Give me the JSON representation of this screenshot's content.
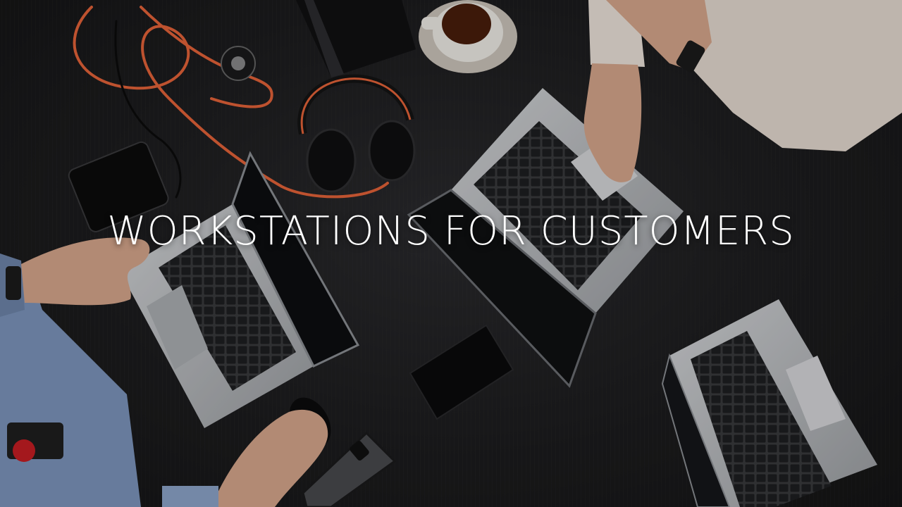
{
  "hero": {
    "headline": "WORKSTATIONS FOR CUSTOMERS"
  },
  "colors": {
    "table": "#1f1f21",
    "laptop_silver": "#bfc2c6",
    "keyboard": "#2a2b2e",
    "cable_orange": "#e8643a",
    "sleeve_beige": "#e8ddd3",
    "shirt_blue": "#7e97bf",
    "skin": "#d9a98e",
    "text": "#ffffff"
  },
  "icons": [
    "laptop-icon",
    "headphones-icon",
    "phone-icon",
    "coffee-cup-icon",
    "mouse-icon",
    "wallet-icon"
  ]
}
